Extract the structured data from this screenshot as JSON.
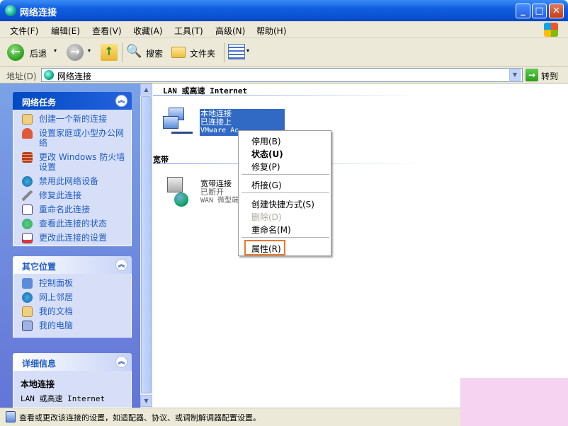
{
  "window": {
    "title": "网络连接",
    "min": "_",
    "max": "□",
    "close": "✕"
  },
  "menu": [
    "文件(F)",
    "编辑(E)",
    "查看(V)",
    "收藏(A)",
    "工具(T)",
    "高级(N)",
    "帮助(H)"
  ],
  "toolbar": {
    "back": "后退",
    "search": "搜索",
    "folders": "文件夹"
  },
  "address": {
    "label": "地址(D)",
    "value": "网络连接",
    "go": "转到"
  },
  "network_tasks": {
    "title": "网络任务",
    "items": [
      "创建一个新的连接",
      "设置家庭或小型办公网络",
      "更改 Windows 防火墙设置",
      "禁用此网络设备",
      "修复此连接",
      "重命名此连接",
      "查看此连接的状态",
      "更改此连接的设置"
    ]
  },
  "other_places": {
    "title": "其它位置",
    "items": [
      "控制面板",
      "网上邻居",
      "我的文档",
      "我的电脑"
    ]
  },
  "details": {
    "title": "详细信息",
    "name": "本地连接",
    "type": "LAN 或高速 Internet"
  },
  "groups": {
    "lan": "LAN 或高速 Internet",
    "broadband": "宽带"
  },
  "local_conn": {
    "name": "本地连接",
    "status": "已连接上",
    "device": "VMware Ac"
  },
  "broadband_conn": {
    "name": "宽带连接",
    "status": "已断开",
    "device": "WAN 微型端"
  },
  "context_menu": [
    "停用(B)",
    "状态(U)",
    "修复(P)",
    "桥接(G)",
    "创建快捷方式(S)",
    "删除(D)",
    "重命名(M)",
    "属性(R)"
  ],
  "status": {
    "text": "查看或更改该连接的设置，如适配器、协议、或调制解调器配置设置。"
  },
  "colors": {
    "accent": "#215dc6",
    "highlight": "#316ac5",
    "focus_box": "#e8792f"
  }
}
